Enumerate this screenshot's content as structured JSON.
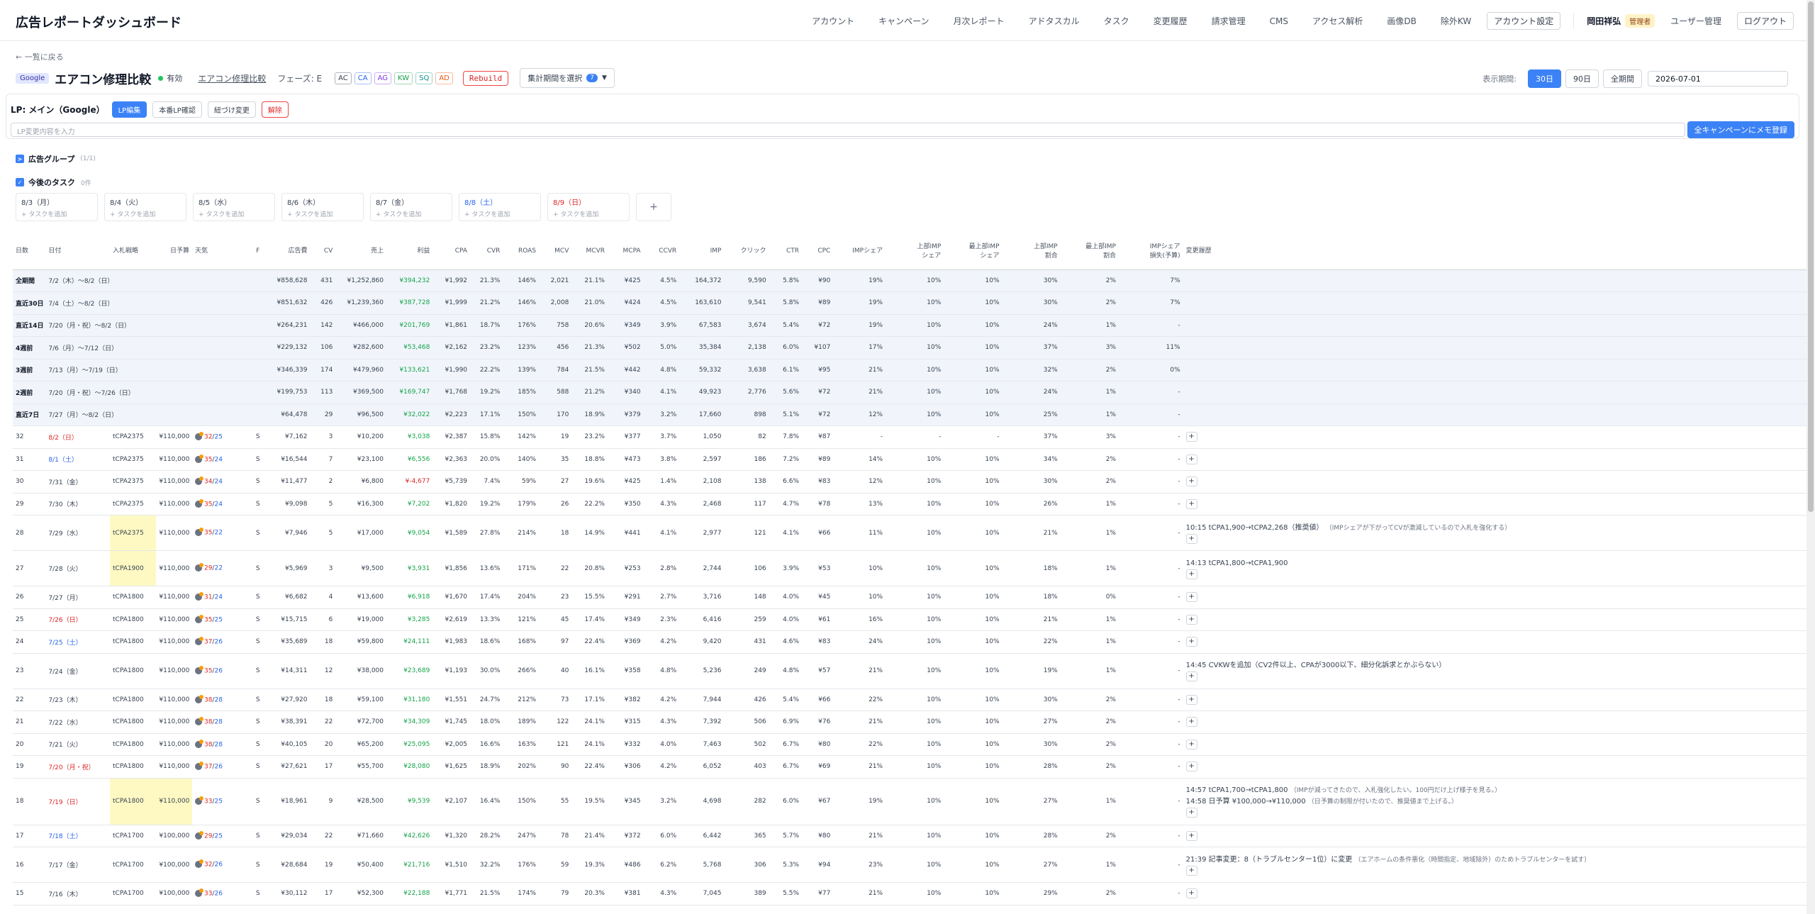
{
  "header": {
    "title": "広告レポートダッシュボード",
    "nav": [
      "アカウント",
      "キャンペーン",
      "月次レポート",
      "アドタスカル",
      "タスク",
      "変更履歴",
      "請求管理",
      "CMS",
      "アクセス解析",
      "画像DB",
      "除外KW"
    ],
    "account_settings": "アカウント設定",
    "user_name": "岡田祥弘",
    "role": "管理者",
    "user_admin": "ユーザー管理",
    "logout": "ログアウト"
  },
  "back_link": "← 一覧に戻る",
  "campaign": {
    "platform": "Google",
    "title": "エアコン修理比較",
    "status": "有効",
    "link_text": "エアコン修理比較",
    "phase": "フェーズ: E",
    "tags": [
      "AC",
      "CA",
      "AG",
      "KW",
      "SQ",
      "AD"
    ],
    "rebuild": "Rebuild",
    "period_select": "集計期間を選択",
    "period_count": "7"
  },
  "period": {
    "label": "表示期間:",
    "options": [
      "30日",
      "90日",
      "全期間"
    ],
    "active": "30日",
    "date": "2026-07-01"
  },
  "lp": {
    "label": "LP: メイン（Google）",
    "buttons": [
      "LP編集",
      "本番LP確認",
      "紐づけ変更",
      "解除"
    ],
    "input_placeholder": "LP変更内容を入力",
    "memo_button": "全キャンペーンにメモ登録"
  },
  "ad_group": {
    "label": "広告グループ",
    "count": "(1/1)",
    "toggle": ">"
  },
  "tasks": {
    "label": "今後のタスク",
    "count": "0件",
    "toggle": "✓",
    "add_text": "+ タスクを追加",
    "plus": "+",
    "days": [
      {
        "date": "8/3（月）",
        "type": ""
      },
      {
        "date": "8/4（火）",
        "type": ""
      },
      {
        "date": "8/5（水）",
        "type": ""
      },
      {
        "date": "8/6（木）",
        "type": ""
      },
      {
        "date": "8/7（金）",
        "type": ""
      },
      {
        "date": "8/8（土）",
        "type": "sat"
      },
      {
        "date": "8/9（日）",
        "type": "sun"
      }
    ]
  },
  "table": {
    "headers": [
      "日数",
      "日付",
      "入札戦略",
      "日予算",
      "天気",
      "F",
      "広告費",
      "CV",
      "売上",
      "利益",
      "CPA",
      "CVR",
      "ROAS",
      "MCV",
      "MCVR",
      "MCPA",
      "CCVR",
      "IMP",
      "クリック",
      "CTR",
      "CPC",
      "IMPシェア",
      "上部IMP|シェア",
      "最上部IMP|シェア",
      "上部IMP|割合",
      "最上部IMP|割合",
      "IMPシェア|損失(予算)",
      "変更履歴"
    ],
    "summary": [
      [
        "全期間",
        "7/2（木）〜8/2（日）",
        "¥858,628",
        "431",
        "¥1,252,860",
        "¥394,232",
        "¥1,992",
        "21.3%",
        "146%",
        "2,021",
        "21.1%",
        "¥425",
        "4.5%",
        "164,372",
        "9,590",
        "5.8%",
        "¥90",
        "19%",
        "10%",
        "10%",
        "30%",
        "2%",
        "7%"
      ],
      [
        "直近30日",
        "7/4（土）〜8/2（日）",
        "¥851,632",
        "426",
        "¥1,239,360",
        "¥387,728",
        "¥1,999",
        "21.2%",
        "146%",
        "2,008",
        "21.0%",
        "¥424",
        "4.5%",
        "163,610",
        "9,541",
        "5.8%",
        "¥89",
        "19%",
        "10%",
        "10%",
        "30%",
        "2%",
        "7%"
      ],
      [
        "直近14日",
        "7/20（月・祝）〜8/2（日）",
        "¥264,231",
        "142",
        "¥466,000",
        "¥201,769",
        "¥1,861",
        "18.7%",
        "176%",
        "758",
        "20.6%",
        "¥349",
        "3.9%",
        "67,583",
        "3,674",
        "5.4%",
        "¥72",
        "19%",
        "10%",
        "10%",
        "24%",
        "1%",
        "-"
      ],
      [
        "4週前",
        "7/6（月）〜7/12（日）",
        "¥229,132",
        "106",
        "¥282,600",
        "¥53,468",
        "¥2,162",
        "23.2%",
        "123%",
        "456",
        "21.3%",
        "¥502",
        "5.0%",
        "35,384",
        "2,138",
        "6.0%",
        "¥107",
        "17%",
        "10%",
        "10%",
        "37%",
        "3%",
        "11%"
      ],
      [
        "3週前",
        "7/13（月）〜7/19（日）",
        "¥346,339",
        "174",
        "¥479,960",
        "¥133,621",
        "¥1,990",
        "22.2%",
        "139%",
        "784",
        "21.5%",
        "¥442",
        "4.8%",
        "59,332",
        "3,638",
        "6.1%",
        "¥95",
        "21%",
        "10%",
        "10%",
        "32%",
        "2%",
        "0%"
      ],
      [
        "2週前",
        "7/20（月・祝）〜7/26（日）",
        "¥199,753",
        "113",
        "¥369,500",
        "¥169,747",
        "¥1,768",
        "19.2%",
        "185%",
        "588",
        "21.2%",
        "¥340",
        "4.1%",
        "49,923",
        "2,776",
        "5.6%",
        "¥72",
        "21%",
        "10%",
        "10%",
        "24%",
        "1%",
        "-"
      ],
      [
        "直近7日",
        "7/27（月）〜8/2（日）",
        "¥64,478",
        "29",
        "¥96,500",
        "¥32,022",
        "¥2,223",
        "17.1%",
        "150%",
        "170",
        "18.9%",
        "¥379",
        "3.2%",
        "17,660",
        "898",
        "5.1%",
        "¥72",
        "12%",
        "10%",
        "10%",
        "25%",
        "1%",
        "-"
      ]
    ],
    "rows": [
      {
        "n": "32",
        "date": "8/2（日）",
        "dt": "sun",
        "bid": "tCPA2375",
        "budget": "¥110,000",
        "hi": "32",
        "lo": "25",
        "f": "S",
        "v": [
          "¥7,162",
          "3",
          "¥10,200",
          "¥3,038",
          "¥2,387",
          "15.8%",
          "142%",
          "19",
          "23.2%",
          "¥377",
          "3.7%",
          "1,050",
          "82",
          "7.8%",
          "¥87",
          "-",
          "-",
          "-",
          "37%",
          "3%",
          "-"
        ]
      },
      {
        "n": "31",
        "date": "8/1（土）",
        "dt": "sat",
        "bid": "tCPA2375",
        "budget": "¥110,000",
        "hi": "35",
        "lo": "24",
        "f": "S",
        "v": [
          "¥16,544",
          "7",
          "¥23,100",
          "¥6,556",
          "¥2,363",
          "20.0%",
          "140%",
          "35",
          "18.8%",
          "¥473",
          "3.8%",
          "2,597",
          "186",
          "7.2%",
          "¥89",
          "14%",
          "10%",
          "10%",
          "34%",
          "2%",
          "-"
        ]
      },
      {
        "n": "30",
        "date": "7/31（金）",
        "dt": "",
        "bid": "tCPA2375",
        "budget": "¥110,000",
        "hi": "34",
        "lo": "24",
        "f": "S",
        "v": [
          "¥11,477",
          "2",
          "¥6,800",
          "¥-4,677",
          "¥5,739",
          "7.4%",
          "59%",
          "27",
          "19.6%",
          "¥425",
          "1.4%",
          "2,108",
          "138",
          "6.6%",
          "¥83",
          "12%",
          "10%",
          "10%",
          "30%",
          "2%",
          "-"
        ]
      },
      {
        "n": "29",
        "date": "7/30（木）",
        "dt": "",
        "bid": "tCPA2375",
        "budget": "¥110,000",
        "hi": "35",
        "lo": "24",
        "f": "S",
        "v": [
          "¥9,098",
          "5",
          "¥16,300",
          "¥7,202",
          "¥1,820",
          "19.2%",
          "179%",
          "26",
          "22.2%",
          "¥350",
          "4.3%",
          "2,468",
          "117",
          "4.7%",
          "¥78",
          "13%",
          "10%",
          "10%",
          "26%",
          "1%",
          "-"
        ]
      },
      {
        "n": "28",
        "date": "7/29（水）",
        "dt": "",
        "bid": "tCPA2375",
        "budget": "¥110,000",
        "hi": "35",
        "lo": "22",
        "f": "S",
        "hlbid": true,
        "tall": 1,
        "v": [
          "¥7,946",
          "5",
          "¥17,000",
          "¥9,054",
          "¥1,589",
          "27.8%",
          "214%",
          "18",
          "14.9%",
          "¥441",
          "4.1%",
          "2,977",
          "121",
          "4.1%",
          "¥66",
          "11%",
          "10%",
          "10%",
          "21%",
          "1%",
          "-"
        ],
        "logs": [
          {
            "t": "10:15 tCPA1,900→tCPA2,268（推奨値）",
            "n": "（IMPシェアが下がってCVが激減しているので入札を強化する）"
          }
        ]
      },
      {
        "n": "27",
        "date": "7/28（火）",
        "dt": "",
        "bid": "tCPA1900",
        "budget": "¥110,000",
        "hi": "29",
        "lo": "22",
        "f": "S",
        "hlbid": true,
        "tall": 1,
        "v": [
          "¥5,969",
          "3",
          "¥9,500",
          "¥3,931",
          "¥1,856",
          "13.6%",
          "171%",
          "22",
          "20.8%",
          "¥253",
          "2.8%",
          "2,744",
          "106",
          "3.9%",
          "¥53",
          "10%",
          "10%",
          "10%",
          "18%",
          "1%",
          "-"
        ],
        "logs": [
          {
            "t": "14:13 tCPA1,800→tCPA1,900",
            "n": ""
          }
        ]
      },
      {
        "n": "26",
        "date": "7/27（月）",
        "dt": "",
        "bid": "tCPA1800",
        "budget": "¥110,000",
        "hi": "31",
        "lo": "24",
        "f": "S",
        "v": [
          "¥6,682",
          "4",
          "¥13,600",
          "¥6,918",
          "¥1,670",
          "17.4%",
          "204%",
          "23",
          "15.5%",
          "¥291",
          "2.7%",
          "3,716",
          "148",
          "4.0%",
          "¥45",
          "10%",
          "10%",
          "10%",
          "18%",
          "0%",
          "-"
        ]
      },
      {
        "n": "25",
        "date": "7/26（日）",
        "dt": "sun",
        "bid": "tCPA1800",
        "budget": "¥110,000",
        "hi": "35",
        "lo": "25",
        "f": "S",
        "v": [
          "¥15,715",
          "6",
          "¥19,000",
          "¥3,285",
          "¥2,619",
          "13.3%",
          "121%",
          "45",
          "17.4%",
          "¥349",
          "2.3%",
          "6,416",
          "259",
          "4.0%",
          "¥61",
          "16%",
          "10%",
          "10%",
          "21%",
          "1%",
          "-"
        ]
      },
      {
        "n": "24",
        "date": "7/25（土）",
        "dt": "sat",
        "bid": "tCPA1800",
        "budget": "¥110,000",
        "hi": "37",
        "lo": "26",
        "f": "S",
        "v": [
          "¥35,689",
          "18",
          "¥59,800",
          "¥24,111",
          "¥1,983",
          "18.6%",
          "168%",
          "97",
          "22.4%",
          "¥369",
          "4.2%",
          "9,420",
          "431",
          "4.6%",
          "¥83",
          "24%",
          "10%",
          "10%",
          "22%",
          "1%",
          "-"
        ]
      },
      {
        "n": "23",
        "date": "7/24（金）",
        "dt": "",
        "bid": "tCPA1800",
        "budget": "¥110,000",
        "hi": "35",
        "lo": "26",
        "f": "S",
        "tall": 1,
        "v": [
          "¥14,311",
          "12",
          "¥38,000",
          "¥23,689",
          "¥1,193",
          "30.0%",
          "266%",
          "40",
          "16.1%",
          "¥358",
          "4.8%",
          "5,236",
          "249",
          "4.8%",
          "¥57",
          "21%",
          "10%",
          "10%",
          "19%",
          "1%",
          "-"
        ],
        "logs": [
          {
            "t": "14:45 CVKWを追加（CV2件以上、CPAが3000以下、細分化訴求とかぶらない）",
            "n": ""
          }
        ]
      },
      {
        "n": "22",
        "date": "7/23（木）",
        "dt": "",
        "bid": "tCPA1800",
        "budget": "¥110,000",
        "hi": "38",
        "lo": "28",
        "f": "S",
        "v": [
          "¥27,920",
          "18",
          "¥59,100",
          "¥31,180",
          "¥1,551",
          "24.7%",
          "212%",
          "73",
          "17.1%",
          "¥382",
          "4.2%",
          "7,944",
          "426",
          "5.4%",
          "¥66",
          "22%",
          "10%",
          "10%",
          "30%",
          "2%",
          "-"
        ]
      },
      {
        "n": "21",
        "date": "7/22（水）",
        "dt": "",
        "bid": "tCPA1800",
        "budget": "¥110,000",
        "hi": "38",
        "lo": "28",
        "f": "S",
        "v": [
          "¥38,391",
          "22",
          "¥72,700",
          "¥34,309",
          "¥1,745",
          "18.0%",
          "189%",
          "122",
          "24.1%",
          "¥315",
          "4.3%",
          "7,392",
          "506",
          "6.9%",
          "¥76",
          "21%",
          "10%",
          "10%",
          "27%",
          "2%",
          "-"
        ]
      },
      {
        "n": "20",
        "date": "7/21（火）",
        "dt": "",
        "bid": "tCPA1800",
        "budget": "¥110,000",
        "hi": "38",
        "lo": "28",
        "f": "S",
        "v": [
          "¥40,105",
          "20",
          "¥65,200",
          "¥25,095",
          "¥2,005",
          "16.6%",
          "163%",
          "121",
          "24.1%",
          "¥332",
          "4.0%",
          "7,463",
          "502",
          "6.7%",
          "¥80",
          "22%",
          "10%",
          "10%",
          "30%",
          "2%",
          "-"
        ]
      },
      {
        "n": "19",
        "date": "7/20（月・祝）",
        "dt": "sun",
        "bid": "tCPA1800",
        "budget": "¥110,000",
        "hi": "37",
        "lo": "26",
        "f": "S",
        "v": [
          "¥27,621",
          "17",
          "¥55,700",
          "¥28,080",
          "¥1,625",
          "18.9%",
          "202%",
          "90",
          "22.4%",
          "¥306",
          "4.2%",
          "6,052",
          "403",
          "6.7%",
          "¥69",
          "21%",
          "10%",
          "10%",
          "28%",
          "2%",
          "-"
        ]
      },
      {
        "n": "18",
        "date": "7/19（日）",
        "dt": "sun",
        "bid": "tCPA1800",
        "budget": "¥110,000",
        "hi": "33",
        "lo": "25",
        "f": "S",
        "hlbid": true,
        "hlbudget": true,
        "tall": 2,
        "v": [
          "¥18,961",
          "9",
          "¥28,500",
          "¥9,539",
          "¥2,107",
          "16.4%",
          "150%",
          "55",
          "19.5%",
          "¥345",
          "3.2%",
          "4,698",
          "282",
          "6.0%",
          "¥67",
          "19%",
          "10%",
          "10%",
          "27%",
          "1%",
          "-"
        ],
        "logs": [
          {
            "t": "14:57 tCPA1,700→tCPA1,800",
            "n": "（IMPが減ってきたので、入札強化したい。100円だけ上げ様子を見る。）"
          },
          {
            "t": "14:58 日予算 ¥100,000→¥110,000",
            "n": "（日予算の制限が付いたので、推奨値まで上げる。）"
          }
        ]
      },
      {
        "n": "17",
        "date": "7/18（土）",
        "dt": "sat",
        "bid": "tCPA1700",
        "budget": "¥100,000",
        "hi": "29",
        "lo": "25",
        "f": "S",
        "v": [
          "¥29,034",
          "22",
          "¥71,660",
          "¥42,626",
          "¥1,320",
          "28.2%",
          "247%",
          "78",
          "21.4%",
          "¥372",
          "6.0%",
          "6,442",
          "365",
          "5.7%",
          "¥80",
          "21%",
          "10%",
          "10%",
          "28%",
          "2%",
          "-"
        ]
      },
      {
        "n": "16",
        "date": "7/17（金）",
        "dt": "",
        "bid": "tCPA1700",
        "budget": "¥100,000",
        "hi": "32",
        "lo": "26",
        "f": "S",
        "tall": 1,
        "v": [
          "¥28,684",
          "19",
          "¥50,400",
          "¥21,716",
          "¥1,510",
          "32.2%",
          "176%",
          "59",
          "19.3%",
          "¥486",
          "6.2%",
          "5,768",
          "306",
          "5.3%",
          "¥94",
          "23%",
          "10%",
          "10%",
          "27%",
          "1%",
          "-"
        ],
        "logs": [
          {
            "t": "21:39 記事変更：8（トラブルセンター1位）に変更",
            "n": "（エアホームの条件悪化（時間指定、地域除外）のためトラブルセンターを試す）"
          }
        ]
      },
      {
        "n": "15",
        "date": "7/16（木）",
        "dt": "",
        "bid": "tCPA1700",
        "budget": "¥100,000",
        "hi": "33",
        "lo": "26",
        "f": "S",
        "v": [
          "¥30,112",
          "17",
          "¥52,300",
          "¥22,188",
          "¥1,771",
          "21.5%",
          "174%",
          "79",
          "20.3%",
          "¥381",
          "4.3%",
          "7,045",
          "389",
          "5.5%",
          "¥77",
          "21%",
          "10%",
          "10%",
          "29%",
          "2%",
          "-"
        ]
      }
    ]
  }
}
